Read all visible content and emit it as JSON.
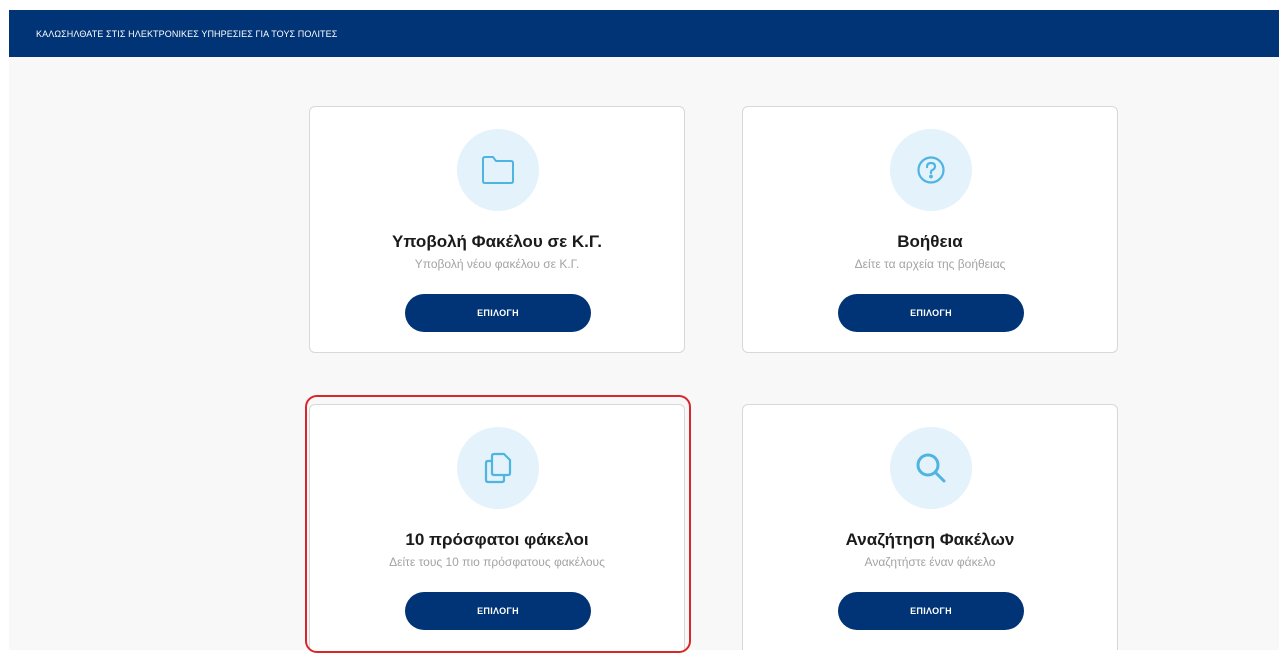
{
  "header": {
    "title": "ΚΑΛΩΣΗΛΘΑΤΕ ΣΤΙΣ ΗΛΕΚΤΡΟΝΙΚΕΣ ΥΠΗΡΕΣΙΕΣ ΓΙΑ ΤΟΥΣ ΠΟΛΙΤΕΣ"
  },
  "colors": {
    "header_bg": "#003476",
    "button_bg": "#003476",
    "icon_circle_bg": "#e3f2fb",
    "icon_stroke": "#4fb5e0",
    "highlight": "#d9262b"
  },
  "cards": [
    {
      "icon": "folder-icon",
      "title": "Υποβολή Φακέλου σε Κ.Γ.",
      "subtitle": "Υποβολή νέου φακέλου σε Κ.Γ.",
      "button_label": "ΕΠΙΛΟΓΗ"
    },
    {
      "icon": "help-icon",
      "title": "Βοήθεια",
      "subtitle": "Δείτε τα αρχεία της βοήθειας",
      "button_label": "ΕΠΙΛΟΓΗ"
    },
    {
      "icon": "copy-icon",
      "title": "10 πρόσφατοι φάκελοι",
      "subtitle": "Δείτε τους 10 πιο πρόσφατους φακέλους",
      "button_label": "ΕΠΙΛΟΓΗ",
      "highlighted": true
    },
    {
      "icon": "search-icon",
      "title": "Αναζήτηση Φακέλων",
      "subtitle": "Αναζητήστε έναν φάκελο",
      "button_label": "ΕΠΙΛΟΓΗ"
    }
  ]
}
